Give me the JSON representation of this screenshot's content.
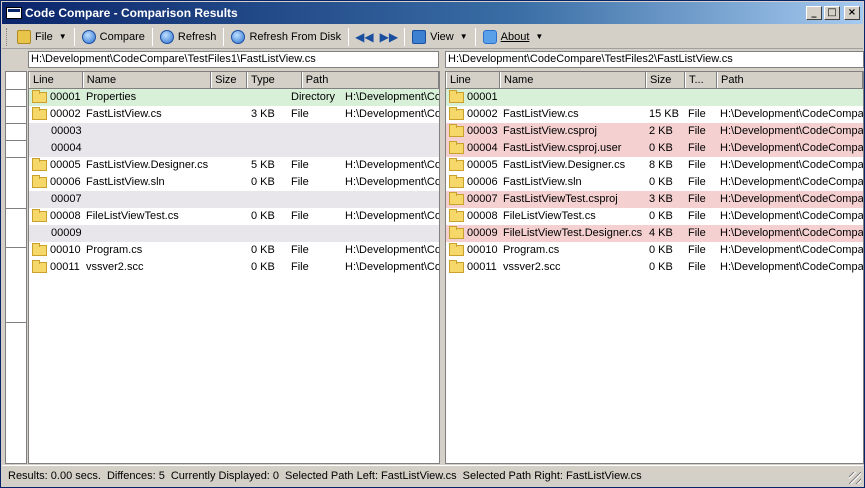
{
  "window": {
    "title": "Code Compare - Comparison Results"
  },
  "toolbar": {
    "file": "File",
    "compare": "Compare",
    "refresh": "Refresh",
    "refresh_disk": "Refresh From Disk",
    "view": "View",
    "about": "About"
  },
  "left": {
    "path": "H:\\Development\\CodeCompare\\TestFiles1\\FastListView.cs",
    "headers": {
      "line": "Line",
      "name": "Name",
      "size": "Size",
      "type": "Type",
      "path": "Path"
    },
    "rows": [
      {
        "line": "00001",
        "name": "Properties",
        "size": "",
        "type": "Directory",
        "path": "H:\\Development\\CodeCompare",
        "state": "green",
        "folder": true
      },
      {
        "line": "00002",
        "name": "FastListView.cs",
        "size": "3 KB",
        "type": "File",
        "path": "H:\\Development\\CodeCompare",
        "state": "",
        "folder": true
      },
      {
        "line": "00003",
        "name": "",
        "size": "",
        "type": "",
        "path": "",
        "state": "gray",
        "folder": false
      },
      {
        "line": "00004",
        "name": "",
        "size": "",
        "type": "",
        "path": "",
        "state": "gray",
        "folder": false
      },
      {
        "line": "00005",
        "name": "FastListView.Designer.cs",
        "size": "5 KB",
        "type": "File",
        "path": "H:\\Development\\CodeCompare",
        "state": "",
        "folder": true
      },
      {
        "line": "00006",
        "name": "FastListView.sln",
        "size": "0 KB",
        "type": "File",
        "path": "H:\\Development\\CodeCompare",
        "state": "",
        "folder": true
      },
      {
        "line": "00007",
        "name": "",
        "size": "",
        "type": "",
        "path": "",
        "state": "gray",
        "folder": false
      },
      {
        "line": "00008",
        "name": "FileListViewTest.cs",
        "size": "0 KB",
        "type": "File",
        "path": "H:\\Development\\CodeCompare",
        "state": "",
        "folder": true
      },
      {
        "line": "00009",
        "name": "",
        "size": "",
        "type": "",
        "path": "",
        "state": "gray",
        "folder": false
      },
      {
        "line": "00010",
        "name": "Program.cs",
        "size": "0 KB",
        "type": "File",
        "path": "H:\\Development\\CodeCompare",
        "state": "",
        "folder": true
      },
      {
        "line": "00011",
        "name": "vssver2.scc",
        "size": "0 KB",
        "type": "File",
        "path": "H:\\Development\\CodeCompare",
        "state": "",
        "folder": true
      }
    ]
  },
  "right": {
    "path": "H:\\Development\\CodeCompare\\TestFiles2\\FastListView.cs",
    "headers": {
      "line": "Line",
      "name": "Name",
      "size": "Size",
      "type": "T...",
      "path": "Path"
    },
    "rows": [
      {
        "line": "00001",
        "name": "",
        "size": "",
        "type": "",
        "path": "",
        "state": "green",
        "folder": true
      },
      {
        "line": "00002",
        "name": "FastListView.cs",
        "size": "15 KB",
        "type": "File",
        "path": "H:\\Development\\CodeCompare",
        "state": "",
        "folder": true
      },
      {
        "line": "00003",
        "name": "FastListView.csproj",
        "size": "2 KB",
        "type": "File",
        "path": "H:\\Development\\CodeCompare",
        "state": "red",
        "folder": true
      },
      {
        "line": "00004",
        "name": "FastListView.csproj.user",
        "size": "0 KB",
        "type": "File",
        "path": "H:\\Development\\CodeCompare",
        "state": "red",
        "folder": true
      },
      {
        "line": "00005",
        "name": "FastListView.Designer.cs",
        "size": "8 KB",
        "type": "File",
        "path": "H:\\Development\\CodeCompare",
        "state": "",
        "folder": true
      },
      {
        "line": "00006",
        "name": "FastListView.sln",
        "size": "0 KB",
        "type": "File",
        "path": "H:\\Development\\CodeCompare",
        "state": "",
        "folder": true
      },
      {
        "line": "00007",
        "name": "FastListViewTest.csproj",
        "size": "3 KB",
        "type": "File",
        "path": "H:\\Development\\CodeCompare",
        "state": "red",
        "folder": true
      },
      {
        "line": "00008",
        "name": "FileListViewTest.cs",
        "size": "0 KB",
        "type": "File",
        "path": "H:\\Development\\CodeCompare",
        "state": "",
        "folder": true
      },
      {
        "line": "00009",
        "name": "FileListViewTest.Designer.cs",
        "size": "4 KB",
        "type": "File",
        "path": "H:\\Development\\CodeCompare",
        "state": "red",
        "folder": true
      },
      {
        "line": "00010",
        "name": "Program.cs",
        "size": "0 KB",
        "type": "File",
        "path": "H:\\Development\\CodeCompare",
        "state": "",
        "folder": true
      },
      {
        "line": "00011",
        "name": "vssver2.scc",
        "size": "0 KB",
        "type": "File",
        "path": "H:\\Development\\CodeCompare",
        "state": "",
        "folder": true
      }
    ]
  },
  "status": {
    "results": "Results: 0.00 secs.",
    "differences": "Diffences: 5",
    "displayed": "Currently Displayed: 0",
    "sel_left": "Selected Path Left: FastListView.cs",
    "sel_right": "Selected Path Right: FastListView.cs"
  },
  "colors": {
    "match": "#d8f0d8",
    "diff": "#f4d0d0",
    "missing": "#e8e6ea",
    "titlebar": "#0a246a"
  },
  "icons": {
    "file": "folder-icon",
    "compare": "compare-icon",
    "refresh": "refresh-icon",
    "view": "view-icon",
    "about": "about-icon",
    "prev": "previous-difference-icon",
    "next": "next-difference-icon"
  }
}
